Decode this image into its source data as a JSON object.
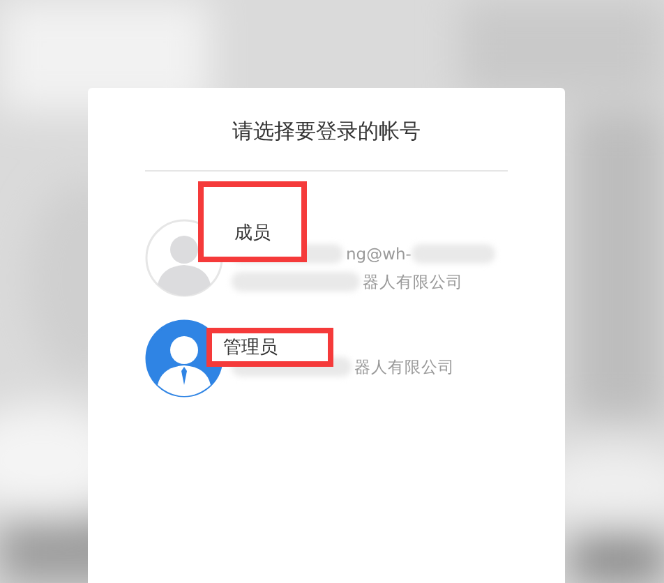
{
  "dialog": {
    "title": "请选择要登录的帐号"
  },
  "accounts": [
    {
      "role": "成员",
      "kind": "member",
      "highlighted": true,
      "email": "ng@wh-",
      "company": "器人有限公司"
    },
    {
      "role": "管理员",
      "kind": "admin",
      "highlighted": true,
      "company": "器人有限公司"
    }
  ]
}
